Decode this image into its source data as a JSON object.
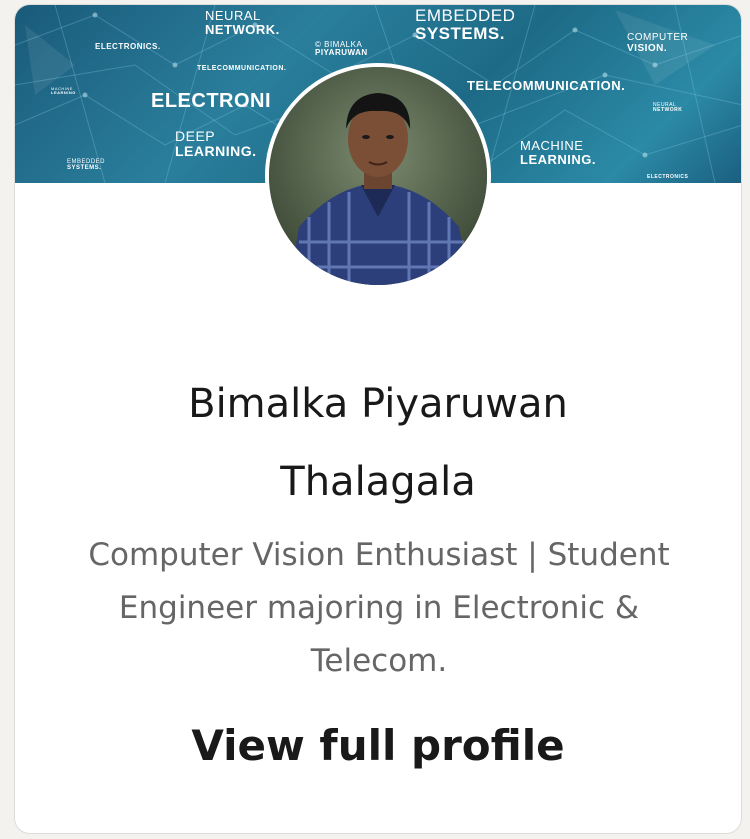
{
  "banner": {
    "tags": [
      {
        "pre": "NEURAL",
        "main": "NETWORK."
      },
      {
        "pre": "EMBEDDED",
        "main": "SYSTEMS."
      },
      {
        "pre": "",
        "main": "ELECTRONICS."
      },
      {
        "pre": "© BIMALKA",
        "main": "PIYARUWAN"
      },
      {
        "pre": "COMPUTER",
        "main": "VISION."
      },
      {
        "pre": "",
        "main": "TELECOMMUNICATION."
      },
      {
        "pre": "",
        "main": "TELECOMMUNICATION."
      },
      {
        "pre": "MACHINE",
        "main": "LEARNING"
      },
      {
        "pre": "",
        "main": "ELECTRONI"
      },
      {
        "pre": "NEURAL",
        "main": "NETWORK"
      },
      {
        "pre": "DEEP",
        "main": "LEARNING."
      },
      {
        "pre": "MACHINE",
        "main": "LEARNING."
      },
      {
        "pre": "EMBEDDED",
        "main": "SYSTEMS."
      },
      {
        "pre": "",
        "main": "ELECTRONICS"
      }
    ]
  },
  "profile": {
    "name_line1": "Bimalka Piyaruwan",
    "name_line2": "Thalagala",
    "headline_line1": "Computer Vision Enthusiast | Student",
    "headline_line2": "Engineer majoring in Electronic &",
    "headline_line3": "Telecom.",
    "cta_label": "View full profile"
  }
}
